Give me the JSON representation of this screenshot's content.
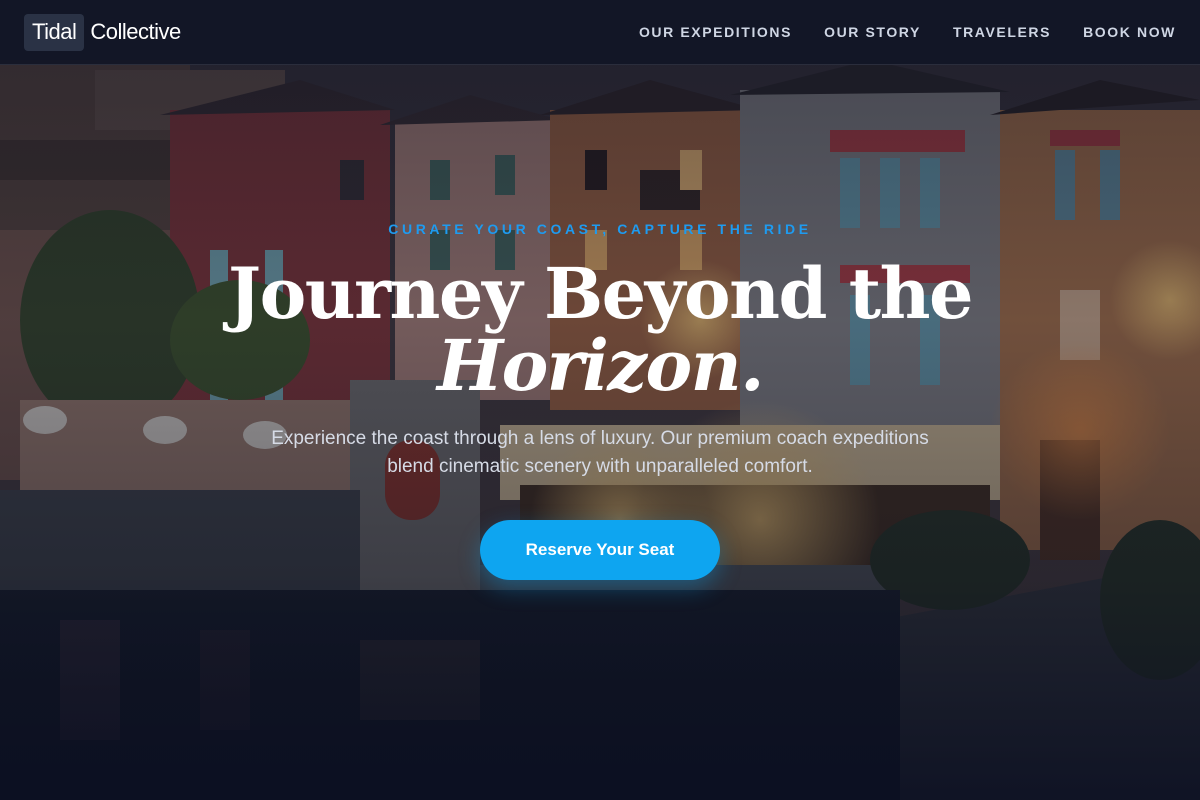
{
  "header": {
    "brand_box": "Tidal",
    "brand_word": "Collective",
    "nav": [
      {
        "label": "OUR EXPEDITIONS"
      },
      {
        "label": "OUR STORY"
      },
      {
        "label": "TRAVELERS"
      },
      {
        "label": "BOOK NOW"
      }
    ]
  },
  "hero": {
    "eyebrow": "CURATE YOUR COAST, CAPTURE THE RIDE",
    "headline_line1": "Journey Beyond the",
    "headline_line2": "Horizon.",
    "subcopy": "Experience the coast through a lens of luxury. Our premium coach expeditions blend cinematic scenery with unparalleled comfort.",
    "cta_label": "Reserve Your Seat",
    "background_image": "lakeside-village-at-dusk"
  },
  "colors": {
    "accent": "#0ea5f0",
    "eyebrow": "#1e9bf0",
    "header_bg": "#111626",
    "page_bg": "#0e1424"
  }
}
